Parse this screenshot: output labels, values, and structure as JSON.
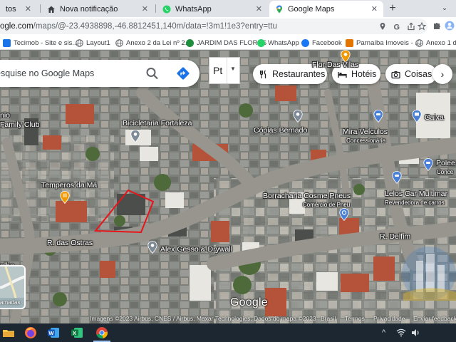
{
  "browser": {
    "tabs": [
      {
        "title": "tos",
        "icon": "generic-page-icon",
        "active": false
      },
      {
        "title": "Nova notificação",
        "icon": "home-icon",
        "active": false
      },
      {
        "title": "WhatsApp",
        "icon": "whatsapp-icon",
        "active": false
      },
      {
        "title": "Google Maps",
        "icon": "maps-pin-icon",
        "active": true
      }
    ],
    "close_glyph": "✕",
    "new_tab_glyph": "+",
    "tab_menu_glyph": "⌄",
    "url_prefix": "ogle.com",
    "url_path": "/maps/@-23.4938898,-46.8812451,140m/data=!3m1!1e3?entry=ttu"
  },
  "bookmarks": [
    {
      "label": "Tecimob - Site e sis...",
      "icon": "tecimob-icon",
      "color": "#1a73e8"
    },
    {
      "label": "Layout1",
      "icon": "globe-icon",
      "color": "#5f6368"
    },
    {
      "label": "Anexo 2 da Lei nº 2...",
      "icon": "globe-icon",
      "color": "#5f6368"
    },
    {
      "label": "JARDIM DAS FLORES",
      "icon": "gov-icon",
      "color": "#1e8e3e"
    },
    {
      "label": "WhatsApp",
      "icon": "whatsapp-icon",
      "color": "#25d366"
    },
    {
      "label": "Facebook",
      "icon": "facebook-icon",
      "color": "#1877f2"
    },
    {
      "label": "Parnaíba Imoveis - ...",
      "icon": "parnaiba-icon",
      "color": "#e37400"
    },
    {
      "label": "Anexo 1 da",
      "icon": "globe-icon",
      "color": "#5f6368"
    }
  ],
  "maps": {
    "search_placeholder": "esquise no Google Maps",
    "language_value": "Pt",
    "chips": [
      {
        "label": "Restaurantes",
        "icon": "fork-knife-icon"
      },
      {
        "label": "Hotéis",
        "icon": "bed-icon"
      },
      {
        "label": "Coisas p",
        "icon": "camera-icon"
      }
    ],
    "chips_next_glyph": "›",
    "places": [
      {
        "name": "Bicicletaria Fortaleza",
        "pin": "gray"
      },
      {
        "name": "Cópias Bernado",
        "pin": "gray"
      },
      {
        "name": "Mira Veículos",
        "pin": "blue",
        "sub": "Concessionária"
      },
      {
        "name": "Caixa",
        "pin": "blue"
      },
      {
        "name": "Temperos da Má",
        "pin": "orange"
      },
      {
        "name": "Borracharia Cosme Pneus",
        "pin": "blue",
        "sub": "Comércio de Pneu"
      },
      {
        "name": "Lelos Car Multimar",
        "pin": "blue",
        "sub": "Revendedora de carros"
      },
      {
        "name": "Alex Gesso & Drywall",
        "pin": "gray"
      },
      {
        "name": "nio",
        "pin": "none"
      },
      {
        "name": "Family Club",
        "pin": "none"
      },
      {
        "name": "Polee",
        "pin": "blue",
        "sub": "Conce"
      },
      {
        "name": "Flor Das Vilas",
        "pin": "orange"
      }
    ],
    "streets": [
      "R. das Ostras",
      "R. Delfim",
      "elho"
    ],
    "layers_label": "amadas",
    "logo": "Google",
    "attribution": "Imagens ©2023 Airbus, CNES / Airbus, Maxar Technologies, Dados do mapa ©2023",
    "footer_links": [
      "Brasil",
      "Termos",
      "Privacidade",
      "Enviar feedback"
    ],
    "selected_outline_color": "#e8141a"
  },
  "taskbar": {
    "apps": [
      {
        "name": "file-explorer-icon"
      },
      {
        "name": "firefox-icon"
      },
      {
        "name": "word-icon"
      },
      {
        "name": "excel-icon"
      },
      {
        "name": "chrome-icon"
      }
    ],
    "tray": {
      "chevron": "^",
      "network": "wifi-icon",
      "volume": "volume-icon"
    }
  }
}
